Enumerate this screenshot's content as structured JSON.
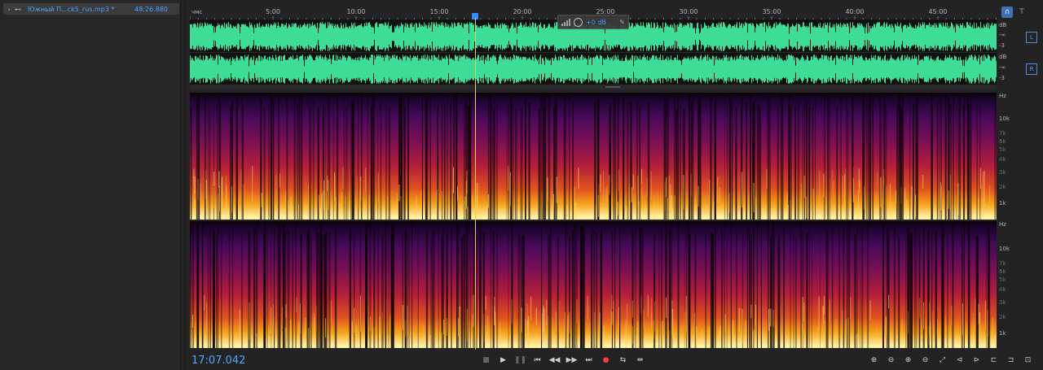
{
  "files_panel": {
    "file": {
      "name": "Южный П...ck5_rus.mp3 *",
      "duration": "48:26.880"
    },
    "expand_icon": "chevron-right-icon",
    "type_icon": "waveform-file-icon"
  },
  "ruler": {
    "unit": "чмс",
    "labels": [
      "5:00",
      "10:00",
      "15:00",
      "20:00",
      "25:00",
      "30:00",
      "35:00",
      "40:00",
      "45:00"
    ]
  },
  "hud": {
    "value": "+0 dB"
  },
  "db_scale": {
    "left": [
      "dB",
      "-∞",
      "-3"
    ],
    "right": [
      "dB",
      "-∞",
      "-3"
    ]
  },
  "channel_buttons": {
    "left": "L",
    "right": "R"
  },
  "hz_scale": {
    "top": {
      "unit": "Hz",
      "labels": [
        "10k",
        "7k",
        "6k",
        "5k",
        "4k",
        "3k",
        "2k",
        "1k"
      ]
    },
    "bottom": {
      "unit": "Hz",
      "labels": [
        "10k",
        "7k",
        "6k",
        "5k",
        "4k",
        "3k",
        "2k",
        "1k"
      ]
    }
  },
  "transport": {
    "time": "17:07.042",
    "playhead_position": 0.353
  },
  "colors": {
    "accent": "#4ea6ff",
    "waveform": "#3ddc97",
    "playhead": "#e7d53a",
    "record": "#ff3b3b"
  }
}
